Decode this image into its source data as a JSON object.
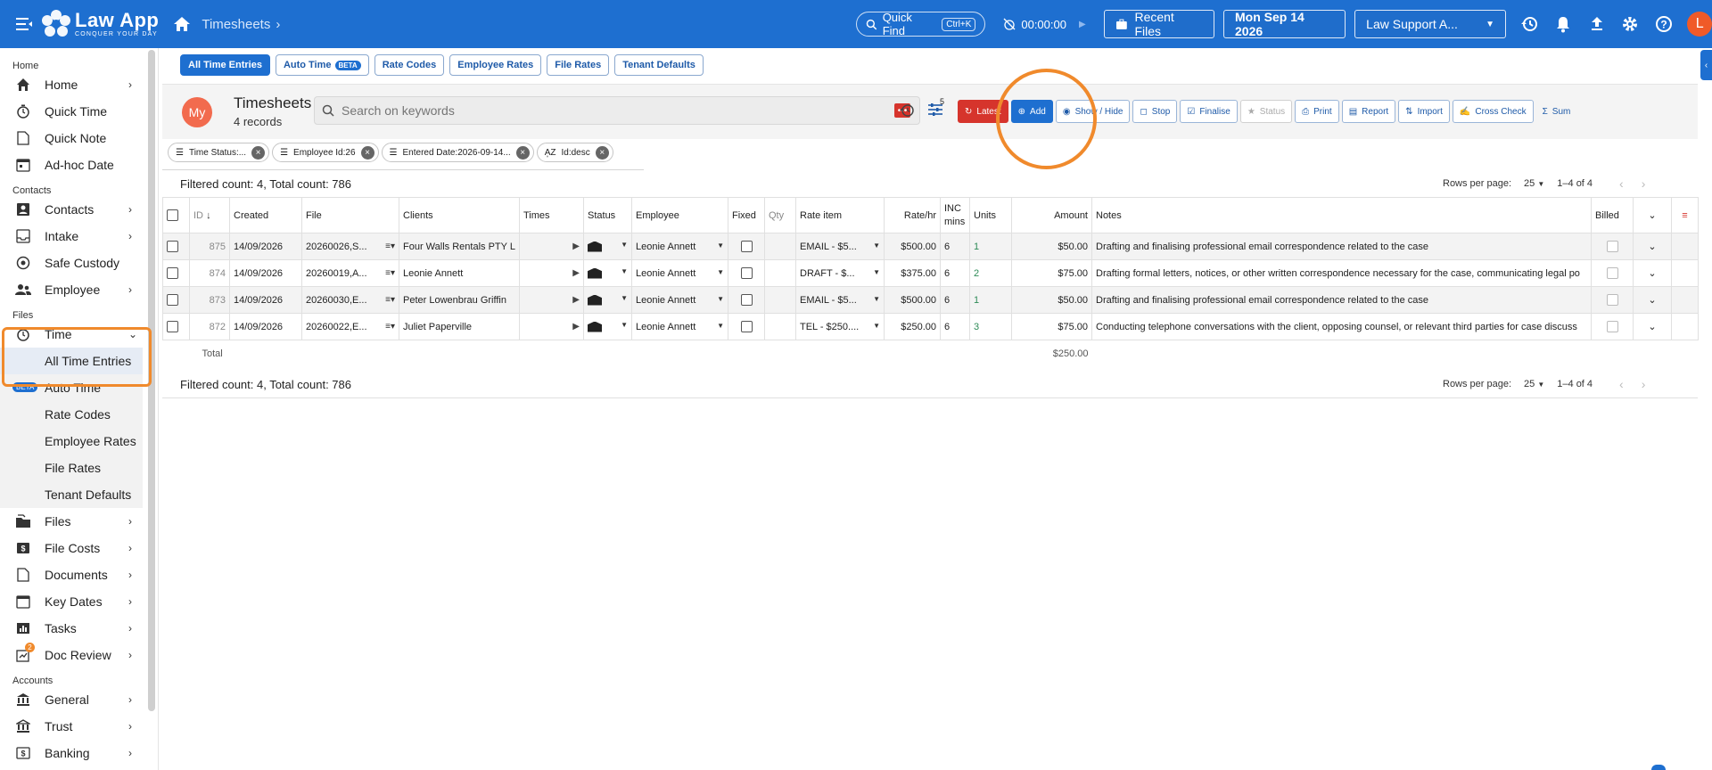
{
  "app": {
    "logo_title": "Law App",
    "logo_tagline": "CONQUER YOUR DAY",
    "breadcrumb": "Timesheets"
  },
  "topbar": {
    "quick_find": "Quick Find",
    "quick_find_kbd": "Ctrl+K",
    "timer": "00:00:00",
    "recent_files": "Recent Files",
    "date": "Mon Sep 14 2026",
    "tenant": "Law Support A...",
    "user_initial": "L",
    "icons": [
      "history-icon",
      "bell-icon",
      "upload-icon",
      "gear-icon",
      "help-icon"
    ]
  },
  "sidebar": {
    "sections": {
      "home": "Home",
      "contacts": "Contacts",
      "files": "Files",
      "accounts": "Accounts"
    },
    "home_items": [
      {
        "label": "Home",
        "icon": "home-icon",
        "chevron": true
      },
      {
        "label": "Quick Time",
        "icon": "stopwatch-icon",
        "chevron": false
      },
      {
        "label": "Quick Note",
        "icon": "note-icon",
        "chevron": false
      },
      {
        "label": "Ad-hoc Date",
        "icon": "calendar-icon",
        "chevron": false
      }
    ],
    "contacts_items": [
      {
        "label": "Contacts",
        "icon": "contacts-icon",
        "chevron": true
      },
      {
        "label": "Intake",
        "icon": "intake-icon",
        "chevron": true
      },
      {
        "label": "Safe Custody",
        "icon": "safe-icon",
        "chevron": false
      },
      {
        "label": "Employee",
        "icon": "employee-icon",
        "chevron": true
      }
    ],
    "time_item": {
      "label": "Time",
      "icon": "stopwatch-icon"
    },
    "time_sub": [
      "All Time Entries",
      "Auto Time",
      "Rate Codes",
      "Employee Rates",
      "File Rates",
      "Tenant Defaults"
    ],
    "beta_label": "BETA",
    "files_items": [
      {
        "label": "Files",
        "icon": "files-icon",
        "chevron": true
      },
      {
        "label": "File Costs",
        "icon": "costs-icon",
        "chevron": true
      },
      {
        "label": "Documents",
        "icon": "document-icon",
        "chevron": true
      },
      {
        "label": "Key Dates",
        "icon": "calendar-icon",
        "chevron": true
      },
      {
        "label": "Tasks",
        "icon": "tasks-icon",
        "chevron": true
      },
      {
        "label": "Doc Review",
        "icon": "review-icon",
        "chevron": true,
        "badge": "2"
      }
    ],
    "accounts_items": [
      {
        "label": "General",
        "icon": "bank-icon",
        "chevron": true
      },
      {
        "label": "Trust",
        "icon": "bank-icon",
        "chevron": true
      },
      {
        "label": "Banking",
        "icon": "banking-icon",
        "chevron": true
      }
    ]
  },
  "tabs": [
    {
      "label": "All Time Entries",
      "active": true
    },
    {
      "label": "Auto Time",
      "beta": "BETA"
    },
    {
      "label": "Rate Codes"
    },
    {
      "label": "Employee Rates"
    },
    {
      "label": "File Rates"
    },
    {
      "label": "Tenant Defaults"
    }
  ],
  "panel": {
    "avatar": "My",
    "title": "Timesheets",
    "subtitle": "4 records",
    "search_placeholder": "Search on keywords",
    "filter_badge": "5",
    "actions": [
      "Latest",
      "Add",
      "Show / Hide",
      "Stop",
      "Finalise",
      "Status",
      "Print",
      "Report",
      "Import",
      "Cross Check",
      "Sum"
    ]
  },
  "chips": [
    {
      "label": "Time Status:...",
      "icon": "filter"
    },
    {
      "label": "Employee Id:26",
      "icon": "filter"
    },
    {
      "label": "Entered Date:2026-09-14...",
      "icon": "filter"
    },
    {
      "label": "Id:desc",
      "icon": "sort"
    }
  ],
  "counts": {
    "text": "Filtered count: 4, Total count: 786",
    "rows_per_page_label": "Rows per page:",
    "rows_per_page": "25",
    "range": "1–4 of 4"
  },
  "table": {
    "headers": [
      "ID",
      "Created",
      "File",
      "Clients",
      "Times",
      "Status",
      "Employee",
      "Fixed",
      "Qty",
      "Rate item",
      "Rate/hr",
      "INC mins",
      "Units",
      "Amount",
      "Notes",
      "Billed"
    ],
    "rows": [
      {
        "id": "875",
        "created": "14/09/2026",
        "file": "20260026,S...",
        "client": "Four Walls Rentals PTY L",
        "employee": "Leonie Annett",
        "rate_item": "EMAIL - $5...",
        "rate": "$500.00",
        "inc": "6",
        "units": "1",
        "amount": "$50.00",
        "notes": "Drafting and finalising professional email correspondence related to the case"
      },
      {
        "id": "874",
        "created": "14/09/2026",
        "file": "20260019,A...",
        "client": "Leonie Annett",
        "employee": "Leonie Annett",
        "rate_item": "DRAFT - $...",
        "rate": "$375.00",
        "inc": "6",
        "units": "2",
        "amount": "$75.00",
        "notes": "Drafting formal letters, notices, or other written correspondence necessary for the case, communicating legal po"
      },
      {
        "id": "873",
        "created": "14/09/2026",
        "file": "20260030,E...",
        "client": "Peter Lowenbrau Griffin",
        "employee": "Leonie Annett",
        "rate_item": "EMAIL - $5...",
        "rate": "$500.00",
        "inc": "6",
        "units": "1",
        "amount": "$50.00",
        "notes": "Drafting and finalising professional email correspondence related to the case"
      },
      {
        "id": "872",
        "created": "14/09/2026",
        "file": "20260022,E...",
        "client": "Juliet Paperville",
        "employee": "Leonie Annett",
        "rate_item": "TEL - $250....",
        "rate": "$250.00",
        "inc": "6",
        "units": "3",
        "amount": "$75.00",
        "notes": "Conducting telephone conversations with the client, opposing counsel, or relevant third parties for case discuss"
      }
    ],
    "total_label": "Total",
    "total_amount": "$250.00"
  },
  "colors": {
    "brand": "#1e6fd0",
    "danger": "#d6342c",
    "highlight": "#f08a2c",
    "avatar": "#f26b4e"
  }
}
